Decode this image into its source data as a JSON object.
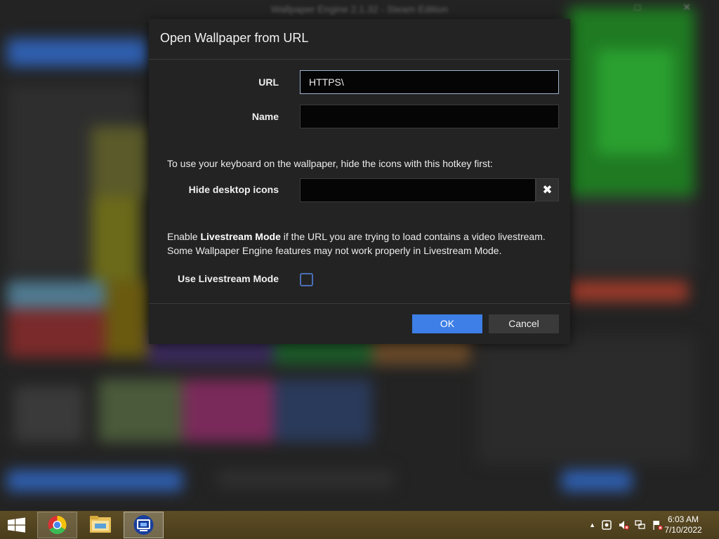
{
  "background": {
    "window_title": "Wallpaper Engine 2.1.32 - Steam Edition",
    "window_controls": "□ ✕"
  },
  "dialog": {
    "title": "Open Wallpaper from URL",
    "url_label": "URL",
    "url_value": "HTTPS\\",
    "name_label": "Name",
    "name_value": "",
    "hotkey_info": "To use your keyboard on the wallpaper, hide the icons with this hotkey first:",
    "hide_icons_label": "Hide desktop icons",
    "hide_icons_value": "",
    "clear_icon": "✖",
    "livestream_info_prefix": "Enable ",
    "livestream_info_bold": "Livestream Mode",
    "livestream_info_suffix": " if the URL you are trying to load contains a video livestream.",
    "livestream_info_line2": "Some Wallpaper Engine features may not work properly in Livestream Mode.",
    "livestream_label": "Use Livestream Mode",
    "livestream_checked": false,
    "ok_label": "OK",
    "cancel_label": "Cancel"
  },
  "taskbar": {
    "apps": [
      "start-icon",
      "chrome-icon",
      "file-explorer-icon",
      "wallpaper-engine-icon"
    ],
    "tray_chevron": "▲",
    "clock_time": "6:03 AM",
    "clock_date": "7/10/2022"
  },
  "colors": {
    "accent": "#3d7fe6",
    "dialog_bg": "#232323",
    "taskbar": "#5a4a22"
  }
}
